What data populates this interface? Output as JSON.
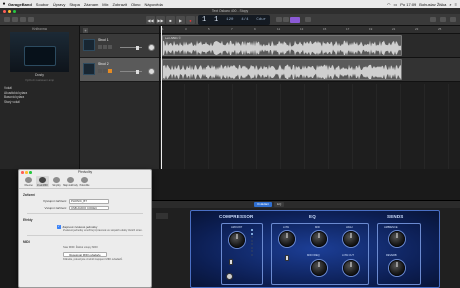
{
  "menubar": {
    "app": "GarageBand",
    "items": [
      "Soubor",
      "Úpravy",
      "Stopa",
      "Záznam",
      "Mix",
      "Zobrazit",
      "Okno",
      "Nápověda"
    ],
    "status_right": "Po 17:09",
    "user": "Bohuslav Žiška"
  },
  "window": {
    "title": "Text Oskaro 400 - Stopy"
  },
  "lcd": {
    "bar": "1",
    "beat": "1",
    "tempo": "120",
    "key": "Cdur",
    "signature": "4/4"
  },
  "colors": {
    "accent": "#2f6fd1",
    "amp_blue": "#1c3e96",
    "record_red": "#e33333",
    "mute_orange": "#e58b23",
    "badge_purple": "#8b5ad6"
  },
  "library": {
    "title": "Knihovna",
    "patch_name": "Dosty",
    "patch_sub": "Výchozí nastavení amp",
    "items": [
      "Vokál",
      "Akustická kytara",
      "Basová kytara",
      "Starý vokál"
    ]
  },
  "tracks": [
    {
      "name": "Stvol 1",
      "selected": false
    },
    {
      "name": "Stvol 2",
      "selected": true
    }
  ],
  "arrange": {
    "ruler": [
      "1",
      "3",
      "5",
      "7",
      "9",
      "11",
      "13",
      "15",
      "17",
      "19",
      "21",
      "23",
      "25"
    ],
    "region_name": "Leit AB01 ©"
  },
  "prefs": {
    "title": "Předvolby",
    "tabs": [
      "Obecné",
      "Zvuk/MIDI",
      "Smyčky",
      "Mají vidchody",
      "Pokročilé"
    ],
    "active_tab": 1,
    "section_devices": "Zařízení",
    "output_label": "Výstupní zařízení:",
    "output_value": "PHONIC_BT",
    "input_label": "Vstupní zařízení:",
    "input_value": "USB AUDIO CODEC",
    "section_effects": "Efekty",
    "effects_check": "Zapnout zvukové jednotky",
    "effects_desc": "Zvukové jednotky umožňují zpracovat ve stopách efekty třetích stran.",
    "section_midi": "MIDI",
    "midi_status": "Stav MIDI: Žádné vstupy MIDI",
    "midi_button": "Resetovat MIDI ovladače",
    "midi_desc": "Klikněte, pokud jste změnili zapojení MIDI ovladačů."
  },
  "smart": {
    "tabs": [
      "Ovládání",
      "EQ"
    ],
    "active_tab": 0,
    "sections": [
      "COMPRESSOR",
      "EQ",
      "SENDS"
    ],
    "knob_labels": [
      "AMOUNT",
      "LOW",
      "MID",
      "HIGH",
      "MID FREQ",
      "LOW CUT",
      "AMBIENCE",
      "REVERB"
    ]
  }
}
